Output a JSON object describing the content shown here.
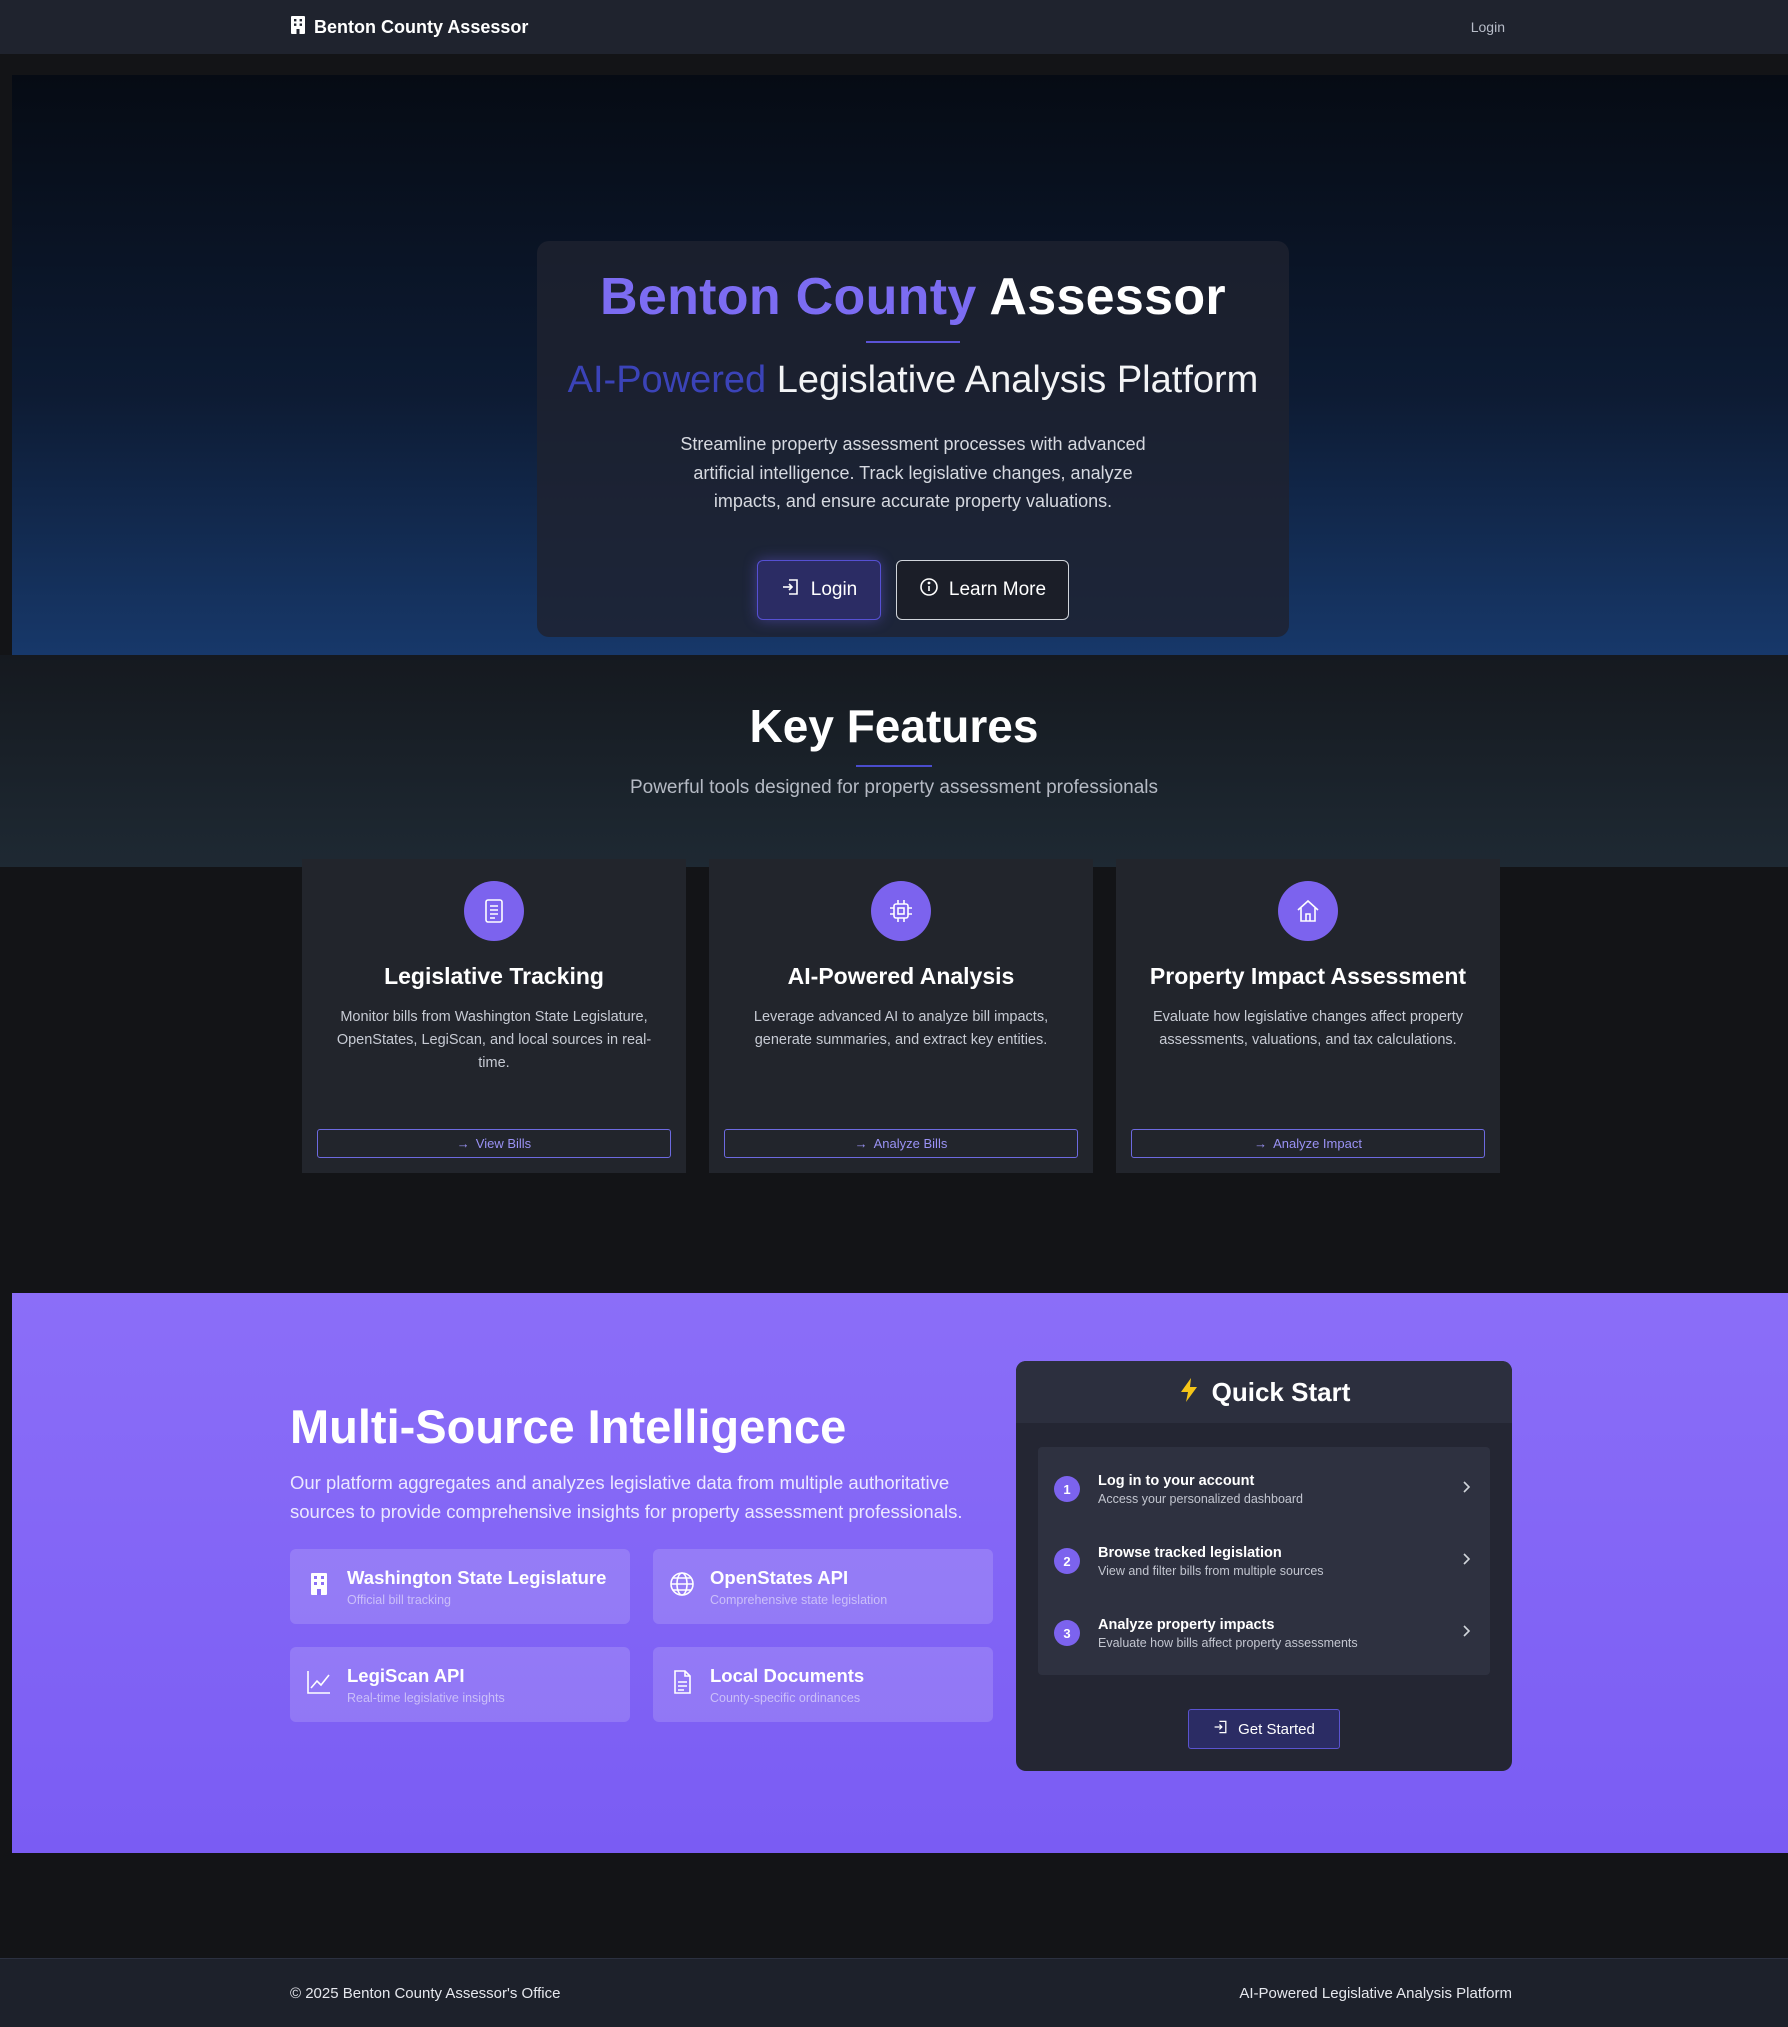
{
  "nav": {
    "brand": "Benton County Assessor",
    "login": "Login"
  },
  "hero": {
    "title_accent": "Benton County",
    "title_rest": "Assessor",
    "subtitle_accent": "AI-Powered",
    "subtitle_rest": "Legislative Analysis Platform",
    "description": "Streamline property assessment processes with advanced artificial intelligence. Track legislative changes, analyze impacts, and ensure accurate property valuations.",
    "login_button": "Login",
    "learn_more_button": "Learn More"
  },
  "features": {
    "title": "Key Features",
    "subtitle": "Powerful tools designed for property assessment professionals",
    "cards": [
      {
        "icon": "document-icon",
        "title": "Legislative Tracking",
        "description": "Monitor bills from Washington State Legislature, OpenStates, LegiScan, and local sources in real-time.",
        "button": "View Bills"
      },
      {
        "icon": "chip-icon",
        "title": "AI-Powered Analysis",
        "description": "Leverage advanced AI to analyze bill impacts, generate summaries, and extract key entities.",
        "button": "Analyze Bills"
      },
      {
        "icon": "house-icon",
        "title": "Property Impact Assessment",
        "description": "Evaluate how legislative changes affect property assessments, valuations, and tax calculations.",
        "button": "Analyze Impact"
      }
    ]
  },
  "multi_source": {
    "title": "Multi-Source Intelligence",
    "description": "Our platform aggregates and analyzes legislative data from multiple authoritative sources to provide comprehensive insights for property assessment professionals.",
    "sources": [
      {
        "icon": "building-icon",
        "name": "Washington State Legislature",
        "sub": "Official bill tracking"
      },
      {
        "icon": "globe-icon",
        "name": "OpenStates API",
        "sub": "Comprehensive state legislation"
      },
      {
        "icon": "chart-line-icon",
        "name": "LegiScan API",
        "sub": "Real-time legislative insights"
      },
      {
        "icon": "file-icon",
        "name": "Local Documents",
        "sub": "County-specific ordinances"
      }
    ]
  },
  "quick_start": {
    "title": "Quick Start",
    "steps": [
      {
        "num": "1",
        "title": "Log in to your account",
        "sub": "Access your personalized dashboard"
      },
      {
        "num": "2",
        "title": "Browse tracked legislation",
        "sub": "View and filter bills from multiple sources"
      },
      {
        "num": "3",
        "title": "Analyze property impacts",
        "sub": "Evaluate how bills affect property assessments"
      }
    ],
    "button": "Get Started"
  },
  "footer": {
    "copyright": "© 2025 Benton County Assessor's Office",
    "tagline": "AI-Powered Legislative Analysis Platform"
  },
  "colors": {
    "accent": "#7c63ee",
    "nav_bg": "#1f232e",
    "multi_bg": "#8b6ef8",
    "bolt": "#f5c518"
  }
}
